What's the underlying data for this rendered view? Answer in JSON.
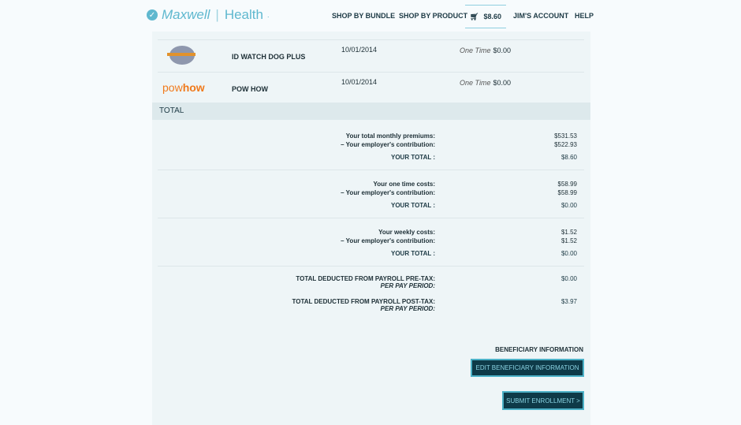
{
  "header": {
    "brand_first": "Maxwell",
    "brand_second": "Health",
    "brand_suffix": ".",
    "nav": [
      "SHOP BY BUNDLE",
      "SHOP BY PRODUCT",
      "JIM'S ACCOUNT",
      "HELP"
    ],
    "cart_total": "$8.60"
  },
  "products": [
    {
      "logo": "idwatchdog",
      "name": "ID WATCH DOG PLUS",
      "date": "10/01/2014",
      "frequency": "One Time",
      "price": "$0.00"
    },
    {
      "logo": "powhow",
      "logo_text_a": "pow",
      "logo_text_b": "how",
      "name": "POW HOW",
      "date": "10/01/2014",
      "frequency": "One Time",
      "price": "$0.00"
    }
  ],
  "total": {
    "heading": "TOTAL",
    "groups": [
      {
        "rows": [
          {
            "label": "Your total monthly premiums:",
            "value": "$531.53"
          },
          {
            "label": "– Your employer's contribution:",
            "value": "$522.93"
          },
          {
            "label": "YOUR TOTAL :",
            "value": "$8.60"
          }
        ]
      },
      {
        "rows": [
          {
            "label": "Your one time costs:",
            "value": "$58.99"
          },
          {
            "label": "– Your employer's contribution:",
            "value": "$58.99"
          },
          {
            "label": "YOUR TOTAL :",
            "value": "$0.00"
          }
        ]
      },
      {
        "rows": [
          {
            "label": "Your weekly costs:",
            "value": "$1.52"
          },
          {
            "label": "– Your employer's contribution:",
            "value": "$1.52"
          },
          {
            "label": "YOUR TOTAL :",
            "value": "$0.00"
          }
        ]
      }
    ],
    "pretax": {
      "label": "TOTAL DEDUCTED FROM PAYROLL PRE-TAX:",
      "sub": "PER PAY PERIOD:",
      "value": "$0.00"
    },
    "posttax": {
      "label": "TOTAL DEDUCTED FROM PAYROLL POST-TAX:",
      "sub": "PER PAY PERIOD:",
      "value": "$3.97"
    }
  },
  "beneficiary": {
    "heading": "BENEFICIARY INFORMATION",
    "edit_button": "EDIT BENEFICIARY INFORMATION"
  },
  "submit_button": "SUBMIT ENROLLMENT >"
}
